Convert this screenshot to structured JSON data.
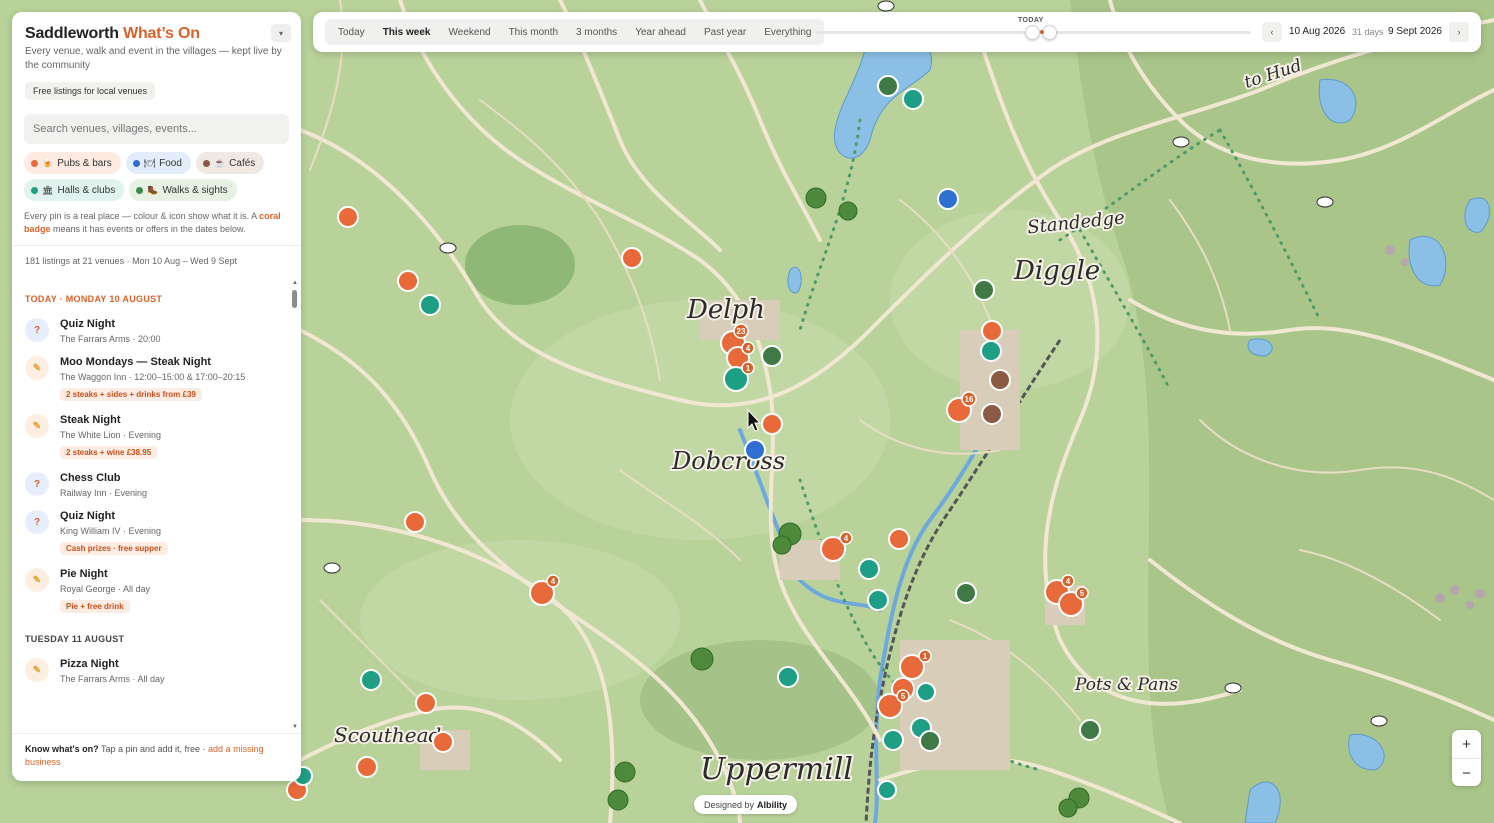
{
  "app": {
    "title_main": "Saddleworth",
    "title_accent": "What’s On",
    "subtitle": "Every venue, walk and event in the villages — kept live by the community",
    "badge": "Free listings for local venues",
    "collapse_icon": "chevron-down-icon"
  },
  "search": {
    "placeholder": "Search venues, villages, events..."
  },
  "chips": [
    {
      "label": "Pubs & bars",
      "color": "#e86a3a",
      "bg": "#fdebe2",
      "icon": "🍺"
    },
    {
      "label": "Food",
      "color": "#2f6fd1",
      "bg": "#e3ecfb",
      "icon": "🍽"
    },
    {
      "label": "Cafés",
      "color": "#8a5a44",
      "bg": "#f0e8e3",
      "icon": "☕"
    },
    {
      "label": "Halls & clubs",
      "color": "#1f9e86",
      "bg": "#e0f3ee",
      "icon": "🏛"
    },
    {
      "label": "Walks & sights",
      "color": "#3f8a4a",
      "bg": "#e6f1e4",
      "icon": "🥾"
    }
  ],
  "note": {
    "text": "Every pin is a real place — colour & icon show what it is. A ",
    "highlight": "coral badge",
    "text_end": " means it has events or offers in the dates below."
  },
  "listing_count": "181 listings at 21 venues · Mon 10 Aug – Wed 9 Sept",
  "days": [
    {
      "heading": "TODAY · MONDAY 10 AUGUST",
      "color": "#d9622b",
      "events": [
        {
          "title": "Quiz Night",
          "sub": "The Farrars Arms · 20:00",
          "tag": "",
          "icon": "?",
          "icon_color": "#d9622b",
          "icon_bg": "#e7eefb"
        },
        {
          "title": "Moo Mondays — Steak Night",
          "sub": "The Waggon Inn · 12:00–15:00 & 17:00–20:15",
          "tag": "2 steaks + sides + drinks from £39",
          "icon": "✎",
          "icon_color": "#e8a13a",
          "icon_bg": "#fdeee2"
        },
        {
          "title": "Steak Night",
          "sub": "The White Lion · Evening",
          "tag": "2 steaks + wine £38.95",
          "icon": "✎",
          "icon_color": "#e8a13a",
          "icon_bg": "#fdeee2"
        },
        {
          "title": "Chess Club",
          "sub": "Railway Inn · Evening",
          "tag": "",
          "icon": "?",
          "icon_color": "#d9622b",
          "icon_bg": "#e7eefb"
        },
        {
          "title": "Quiz Night",
          "sub": "King William IV · Evening",
          "tag": "Cash prizes · free supper",
          "icon": "?",
          "icon_color": "#d9622b",
          "icon_bg": "#e7eefb"
        },
        {
          "title": "Pie Night",
          "sub": "Royal George · All day",
          "tag": "Pie + free drink",
          "icon": "✎",
          "icon_color": "#e8a13a",
          "icon_bg": "#fdeee2"
        }
      ]
    },
    {
      "heading": "TUESDAY 11 AUGUST",
      "color": "#444444",
      "events": [
        {
          "title": "Pizza Night",
          "sub": "The Farrars Arms · All day",
          "tag": "",
          "icon": "✎",
          "icon_color": "#e8a13a",
          "icon_bg": "#fdeee2"
        }
      ]
    }
  ],
  "footer": {
    "bold": "Know what's on?",
    "text": " Tap a pin and add it, free · ",
    "link": "add a missing business"
  },
  "ranges": [
    {
      "label": "Today",
      "active": false
    },
    {
      "label": "This week",
      "active": true
    },
    {
      "label": "Weekend",
      "active": false
    },
    {
      "label": "This month",
      "active": false
    },
    {
      "label": "3 months",
      "active": false
    },
    {
      "label": "Year ahead",
      "active": false
    },
    {
      "label": "Past year",
      "active": false
    },
    {
      "label": "Everything",
      "active": false
    }
  ],
  "timeline": {
    "today_label": "TODAY",
    "date_from": "10 Aug 2026",
    "days": "31 days",
    "date_to": "9 Sept 2026",
    "prev_icon": "chevron-left-icon",
    "next_icon": "chevron-right-icon"
  },
  "zoom": {
    "in": "+",
    "out": "−"
  },
  "credit": {
    "text": "Designed by",
    "brand": "Albility"
  },
  "places": [
    {
      "id": "delph",
      "name": "Delph"
    },
    {
      "id": "dobcross",
      "name": "Dobcross"
    },
    {
      "id": "diggle",
      "name": "Diggle"
    },
    {
      "id": "standedge",
      "name": "Standedge"
    },
    {
      "id": "uppermill",
      "name": "Uppermill"
    },
    {
      "id": "scouthead",
      "name": "Scouthead"
    },
    {
      "id": "potspans",
      "name": "Pots & Pans"
    },
    {
      "id": "tohud",
      "name": "to Hud"
    }
  ],
  "pin_badges": [
    "23",
    "4",
    "1",
    "16",
    "4",
    "4",
    "5",
    "1",
    "5",
    "4"
  ],
  "colors": {
    "coral": "#e86a3a",
    "teal": "#1f9e86",
    "green": "#3f7a46",
    "blue": "#2f6fd1",
    "brown": "#8a5a44",
    "water": "#8cbfe6",
    "land": "#b9d29a"
  }
}
